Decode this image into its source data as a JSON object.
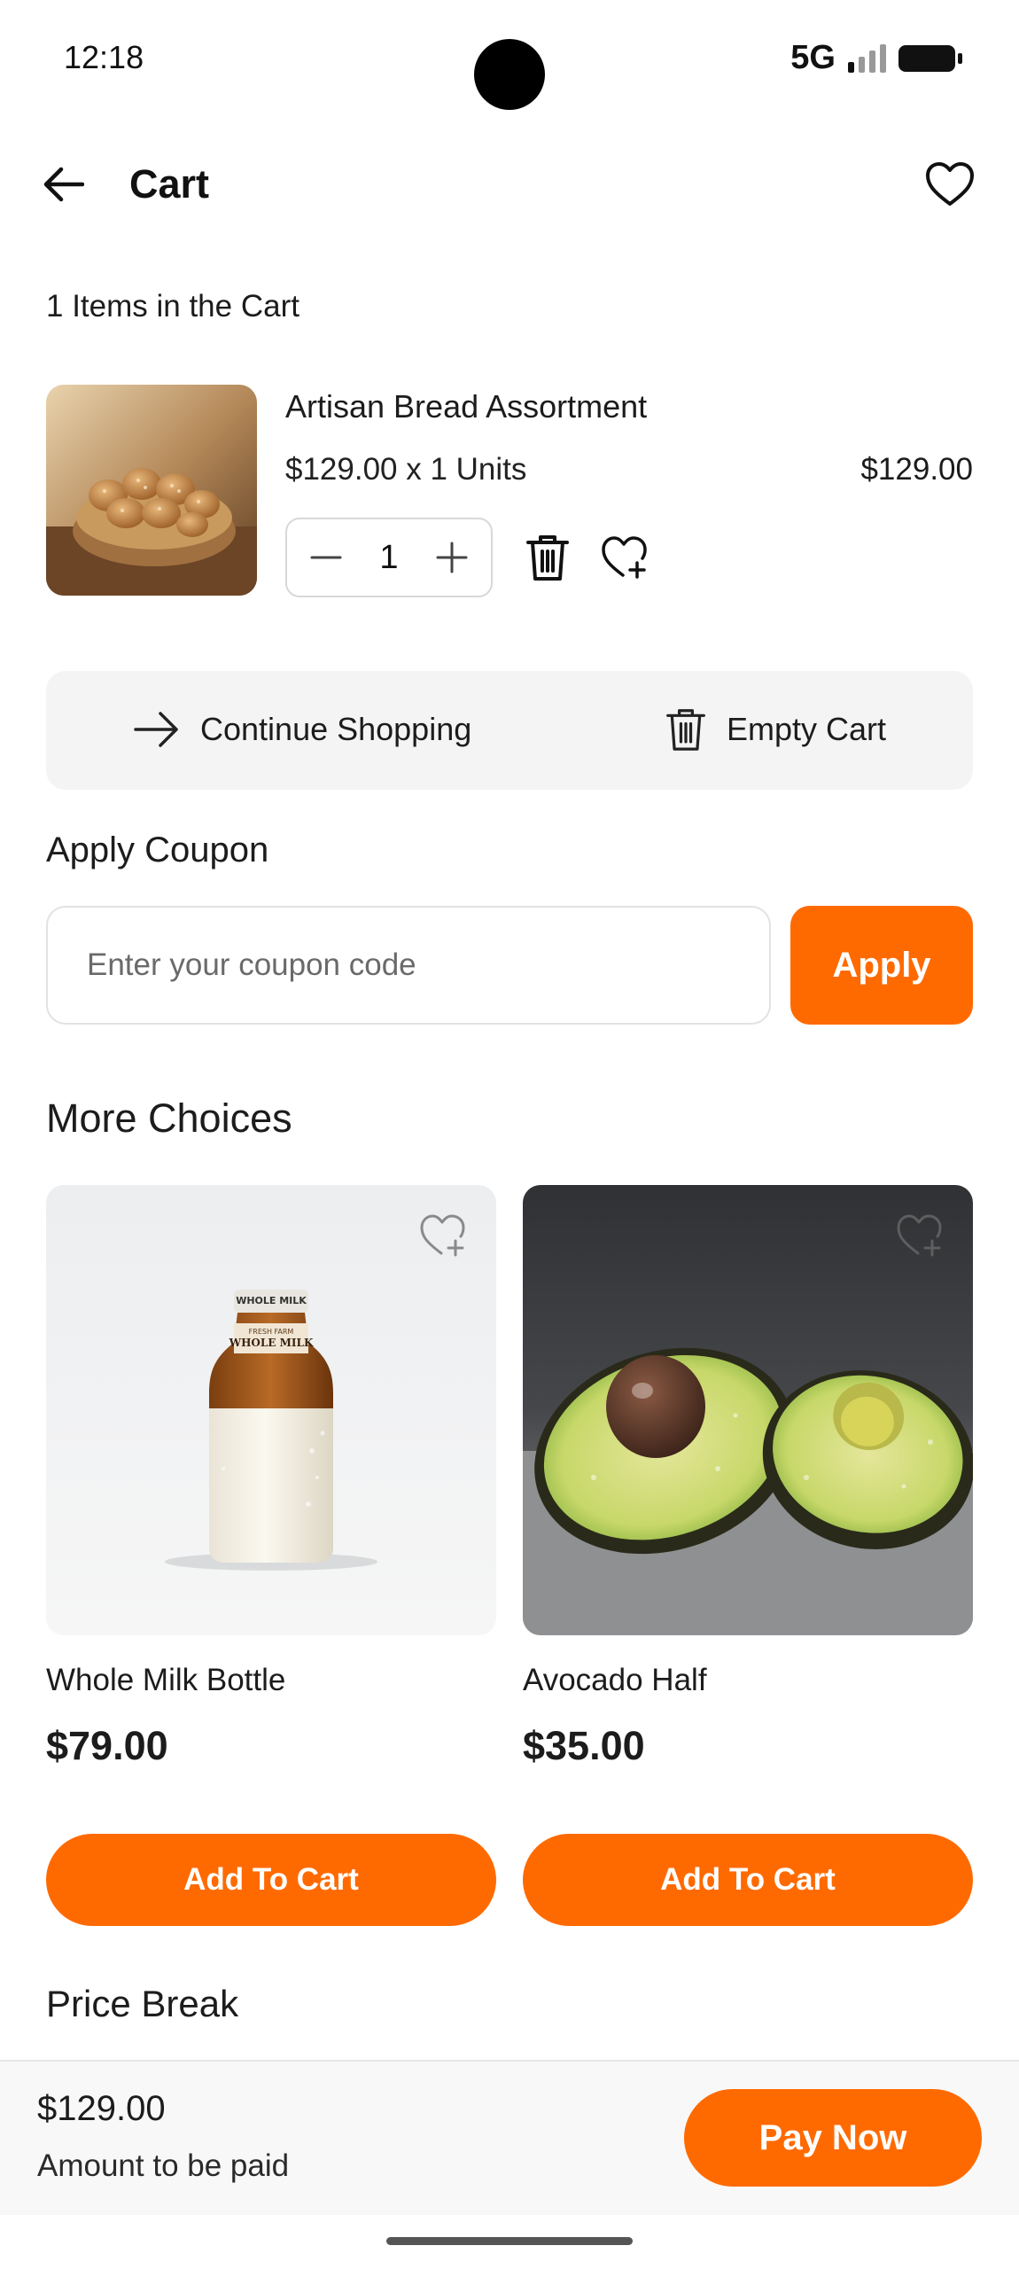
{
  "status_bar": {
    "time": "12:18",
    "network": "5G"
  },
  "header": {
    "title": "Cart",
    "back_icon": "arrow-left-icon",
    "wishlist_icon": "heart-outline-icon"
  },
  "cart": {
    "count_label": "1 Items in the Cart",
    "items": [
      {
        "name": "Artisan Bread Assortment",
        "unit_line": "$129.00 x 1 Units",
        "total": "$129.00",
        "quantity": "1",
        "image": "bread-basket-photo"
      }
    ]
  },
  "actions": {
    "continue_label": "Continue Shopping",
    "empty_label": "Empty Cart"
  },
  "coupon": {
    "title": "Apply Coupon",
    "placeholder": "Enter your coupon code",
    "apply_label": "Apply"
  },
  "more_choices": {
    "title": "More Choices",
    "products": [
      {
        "name": "Whole Milk Bottle",
        "price": "$79.00",
        "button_label": "Add To Cart",
        "bottle_label_lines": [
          "WHOLE MILK",
          "FRESH FARM",
          "WHOLE MILK"
        ],
        "image": "milk-bottle-photo"
      },
      {
        "name": "Avocado Half",
        "price": "$35.00",
        "button_label": "Add To Cart",
        "image": "avocado-photo"
      }
    ]
  },
  "price_break": {
    "title": "Price Break"
  },
  "footer": {
    "amount": "$129.00",
    "amount_label": "Amount to be paid",
    "pay_label": "Pay Now"
  },
  "colors": {
    "accent": "#ff6a00",
    "surface": "#f4f4f4",
    "text": "#1c1c1c"
  }
}
